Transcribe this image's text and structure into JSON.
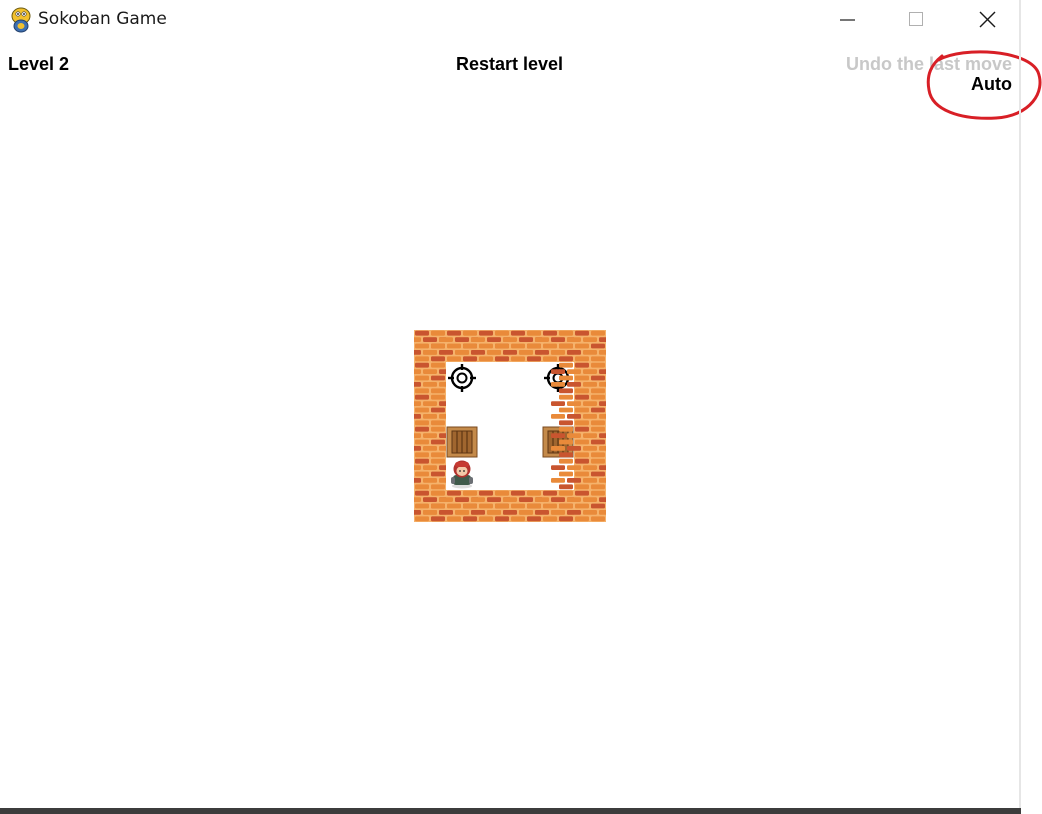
{
  "window": {
    "title": "Sokoban Game",
    "app_icon": "python-snake-icon",
    "controls": [
      "minimize-icon",
      "maximize-icon",
      "close-icon"
    ]
  },
  "hud": {
    "level_label": "Level 2",
    "restart_label": "Restart level",
    "undo_label": "Undo the last move",
    "auto_label": "Auto"
  },
  "annotation": {
    "shape": "hand-drawn circle",
    "color": "#d81f26"
  },
  "colors": {
    "brick": "#e98a3a",
    "brick_dark": "#c9552f",
    "mortar": "#f5b26b",
    "crate": "#a0662f",
    "background": "#ffffff"
  },
  "board": {
    "legend": {
      "W": "wall",
      "T": "target",
      "B": "box",
      "P": "player",
      ".": "floor"
    },
    "rows": [
      "WWWWWW",
      "WT..TW",
      "W....W",
      "WB..BW",
      "WP...W",
      "WWWWWW"
    ]
  }
}
